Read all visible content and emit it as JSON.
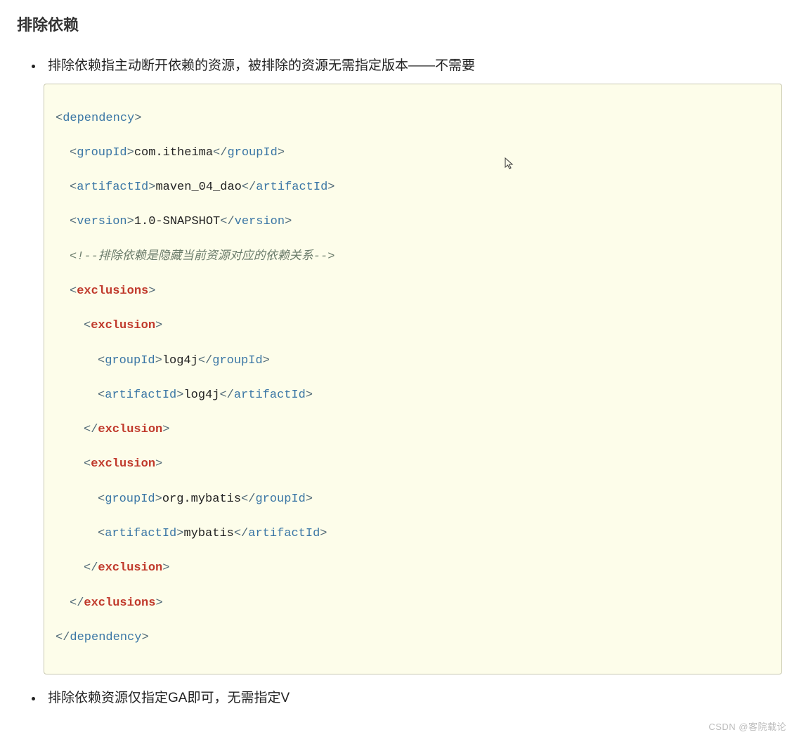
{
  "title": "排除依赖",
  "bullets": {
    "one": "排除依赖指主动断开依赖的资源，被排除的资源无需指定版本——不需要",
    "two": "排除依赖资源仅指定GA即可，无需指定V"
  },
  "code": {
    "tags": {
      "dependency": "dependency",
      "groupId": "groupId",
      "artifactId": "artifactId",
      "version": "version",
      "exclusions": "exclusions",
      "exclusion": "exclusion"
    },
    "values": {
      "groupId_top": "com.itheima",
      "artifactId_top": "maven_04_dao",
      "version_top": "1.0-SNAPSHOT",
      "comment": "<!--排除依赖是隐藏当前资源对应的依赖关系-->",
      "excl1_groupId": "log4j",
      "excl1_artifactId": "log4j",
      "excl2_groupId": "org.mybatis",
      "excl2_artifactId": "mybatis"
    }
  },
  "watermark": "CSDN @客院载论"
}
